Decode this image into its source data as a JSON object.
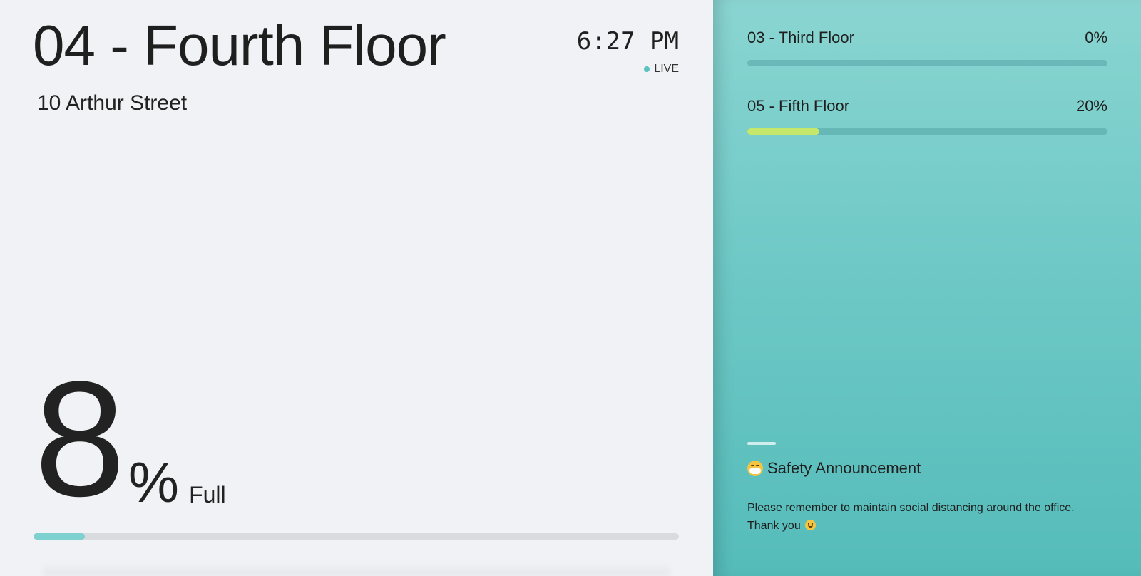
{
  "current_floor": {
    "title": "04 - Fourth Floor",
    "address": "10 Arthur Street",
    "time": "6:27 PM",
    "status": "LIVE",
    "occupancy_value": "8",
    "occupancy_unit": "%",
    "occupancy_label": "Full",
    "occupancy_fraction": 0.08
  },
  "other_floors": [
    {
      "name": "03 - Third Floor",
      "percent_label": "0%",
      "fraction": 0.0
    },
    {
      "name": "05 - Fifth Floor",
      "percent_label": "20%",
      "fraction": 0.2
    }
  ],
  "announcement": {
    "icon": "face-with-medical-mask-icon",
    "title": "Safety Announcement",
    "body_line1": "Please remember to maintain social distancing around the office.",
    "body_line2": "Thank you",
    "body_icon": "smiling-face-icon"
  },
  "colors": {
    "accent": "#5ac2c1",
    "occupancy_bar": "#7fd1cf",
    "floor_bar_fill": "#c6e86a",
    "panel_top": "#8ad5d2",
    "panel_bottom": "#55bcba"
  }
}
